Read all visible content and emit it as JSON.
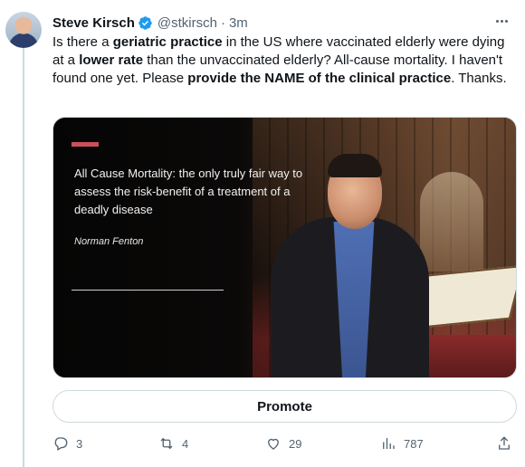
{
  "tweet": {
    "author_name": "Steve Kirsch",
    "handle": "@stkirsch",
    "separator": "·",
    "time": "3m",
    "text_parts": [
      {
        "text": "Is there a ",
        "bold": false
      },
      {
        "text": "geriatric practice",
        "bold": true
      },
      {
        "text": " in the US where vaccinated elderly were dying at a ",
        "bold": false
      },
      {
        "text": "lower rate",
        "bold": true
      },
      {
        "text": " than the unvaccinated elderly? All-cause mortality. I haven't found one yet. Please ",
        "bold": false
      },
      {
        "text": "provide the NAME of the clinical practice",
        "bold": true
      },
      {
        "text": ". Thanks.",
        "bold": false
      }
    ]
  },
  "media": {
    "quote": "All Cause Mortality:  the only truly fair way to assess the risk-benefit of a treatment of a deadly disease",
    "author": "Norman Fenton"
  },
  "promote_label": "Promote",
  "actions": {
    "replies": "3",
    "retweets": "4",
    "likes": "29",
    "views": "787"
  },
  "colors": {
    "verified": "#1d9bf0",
    "text": "#0f1419",
    "muted": "#536471",
    "border": "#cfd9de",
    "slide_accent": "#c9505a"
  },
  "icons": [
    "verified-badge-icon",
    "more-icon",
    "reply-icon",
    "retweet-icon",
    "like-icon",
    "views-icon",
    "share-icon"
  ]
}
